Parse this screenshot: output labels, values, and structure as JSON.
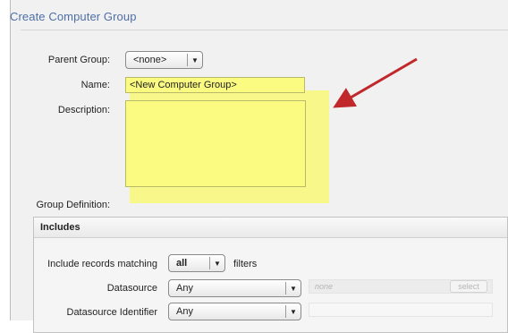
{
  "page": {
    "title": "Create Computer Group"
  },
  "form": {
    "parent_group": {
      "label": "Parent Group:",
      "value": "<none>"
    },
    "name": {
      "label": "Name:",
      "value": "<New Computer Group>"
    },
    "description": {
      "label": "Description:",
      "value": ""
    },
    "group_definition": {
      "label": "Group Definition:"
    }
  },
  "includes": {
    "header": "Includes",
    "records_matching": {
      "label": "Include records matching",
      "value": "all",
      "suffix": "filters"
    },
    "datasource": {
      "label": "Datasource",
      "value": "Any",
      "field_placeholder": "none",
      "select_label": "select"
    },
    "datasource_identifier": {
      "label": "Datasource Identifier",
      "value": "Any"
    }
  },
  "colors": {
    "title": "#4e6fa6",
    "highlight": "#f8f878",
    "annotation_arrow": "#c0282b"
  },
  "icons": {
    "dropdown": "chevron-down-icon",
    "annotation": "red-arrow-annotation"
  }
}
